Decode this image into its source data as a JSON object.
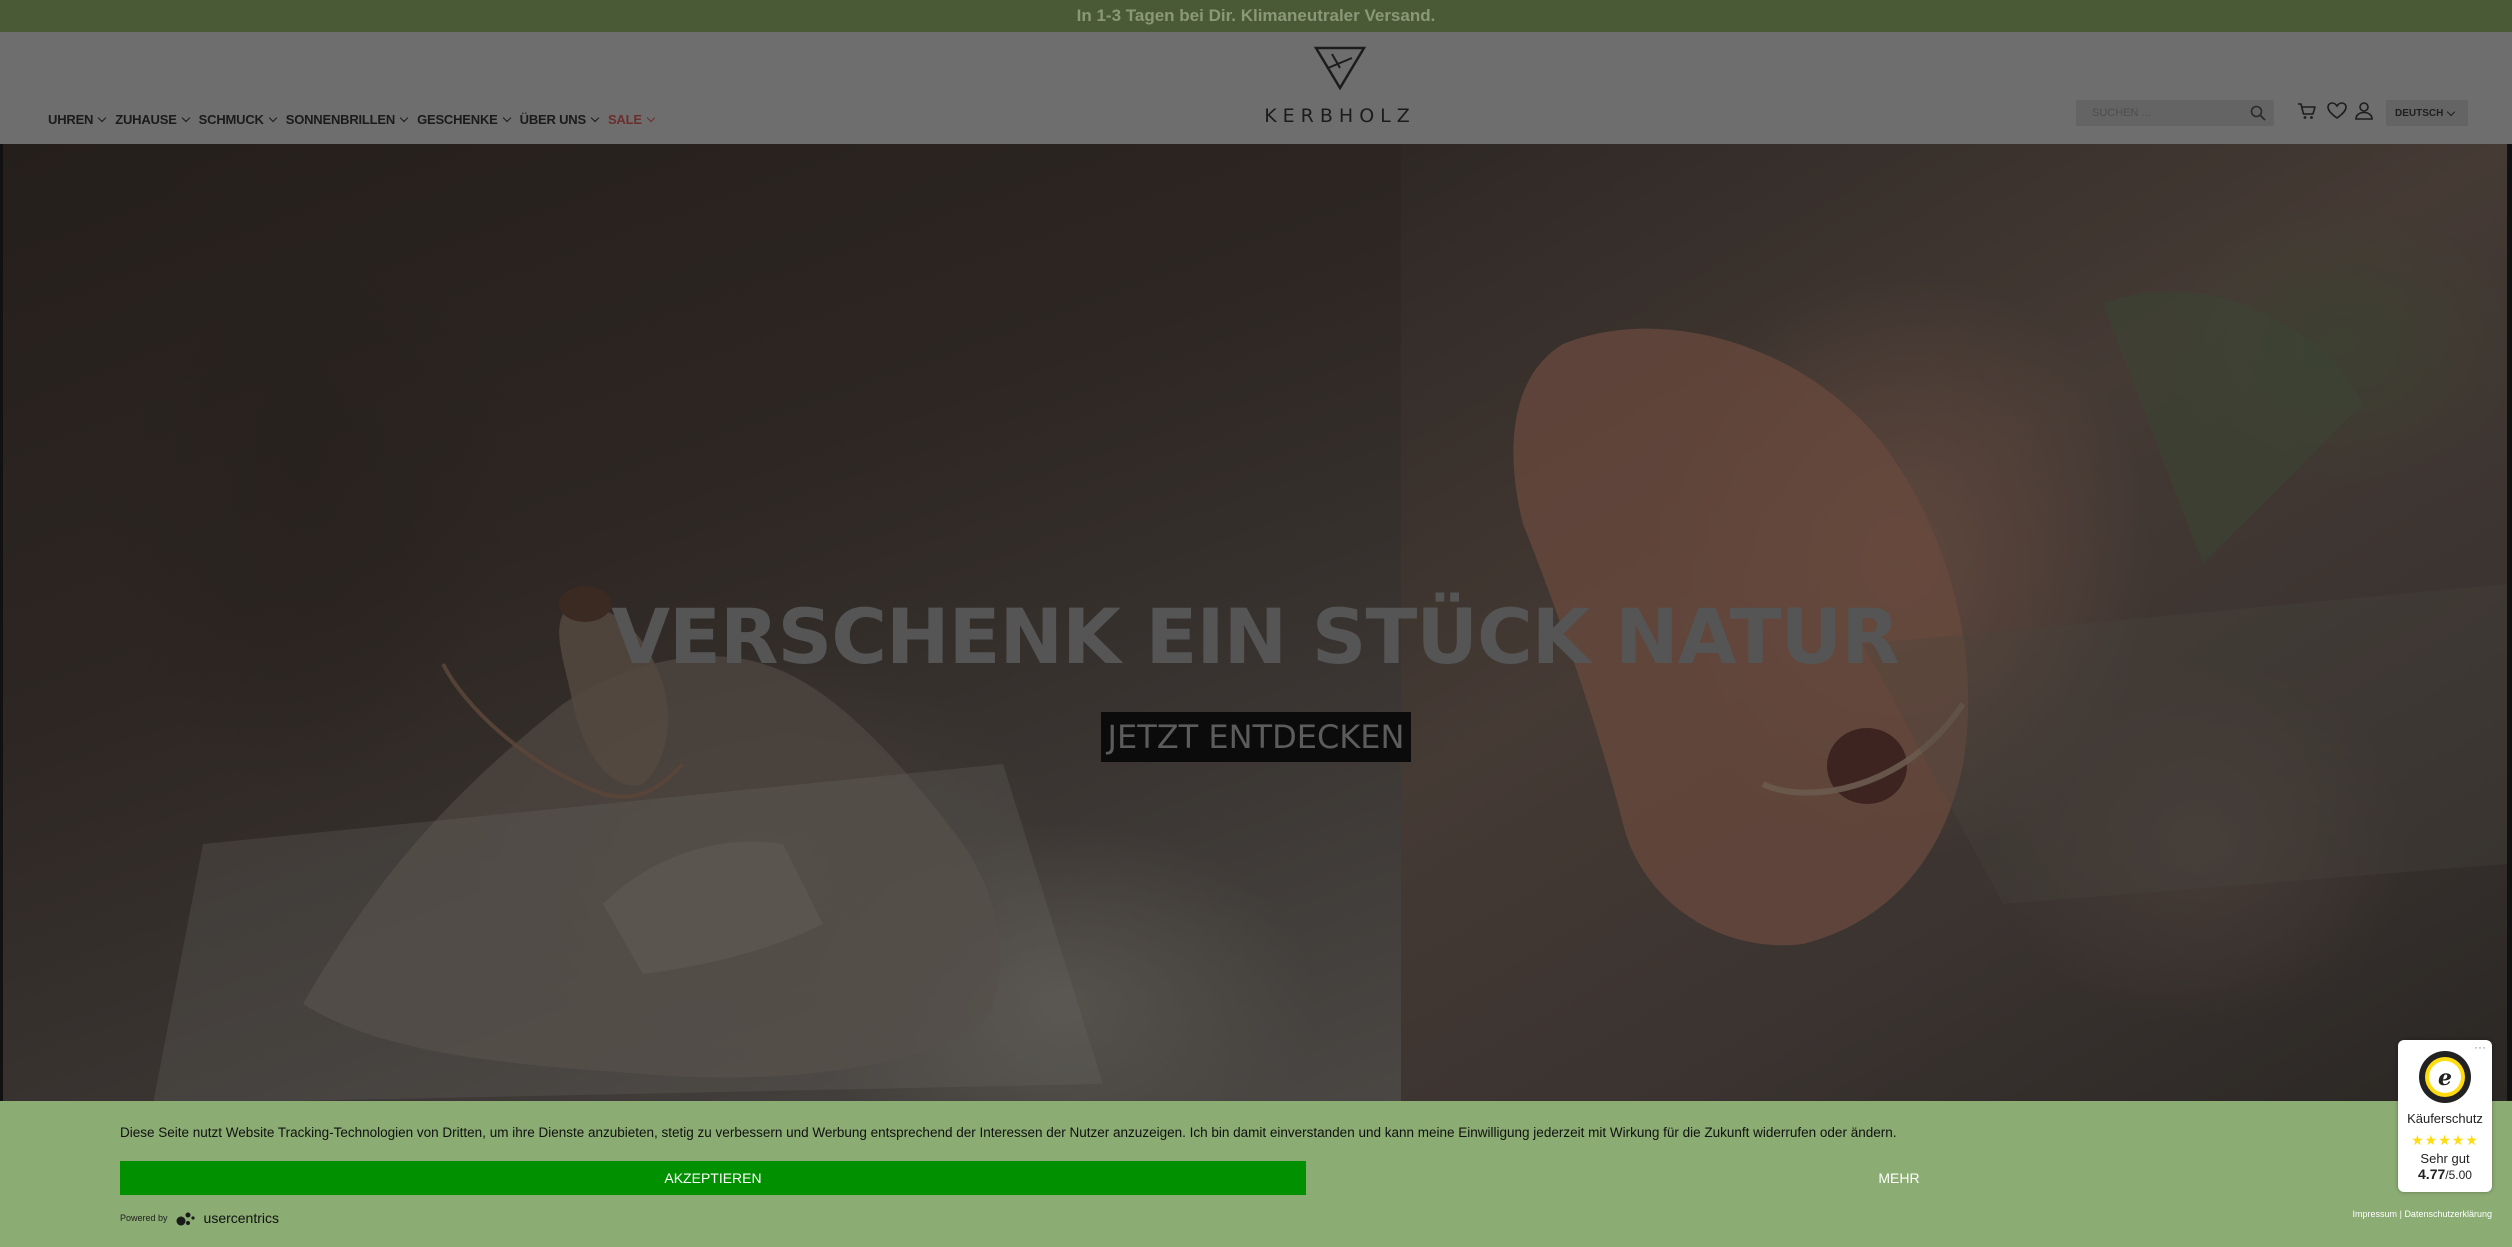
{
  "promo_bar": {
    "text": "In 1-3 Tagen bei Dir. Klimaneutraler Versand."
  },
  "header": {
    "nav": [
      {
        "label": "UHREN"
      },
      {
        "label": "ZUHAUSE"
      },
      {
        "label": "SCHMUCK"
      },
      {
        "label": "SONNENBRILLEN"
      },
      {
        "label": "GESCHENKE"
      },
      {
        "label": "ÜBER UNS"
      },
      {
        "label": "SALE"
      }
    ],
    "logo_text": "KERBHOLZ",
    "search": {
      "placeholder": "SUCHEN ..."
    },
    "icons": [
      "cart-icon",
      "wishlist-heart-icon",
      "account-user-icon"
    ],
    "language": "DEUTSCH"
  },
  "hero": {
    "title": "VERSCHENK EIN STÜCK NATUR",
    "cta_label": "JETZT ENTDECKEN"
  },
  "cookie_banner": {
    "text": "Diese Seite nutzt Website Tracking-Technologien von Dritten, um ihre Dienste anzubieten, stetig zu verbessern und Werbung entsprechend der Interessen der Nutzer anzuzeigen. Ich bin damit einverstanden und kann meine Einwilligung jederzeit mit Wirkung für die Zukunft widerrufen oder ändern.",
    "accept_label": "AKZEPTIEREN",
    "more_label": "MEHR",
    "powered_by": "Powered by",
    "brand": "usercentrics",
    "impressum": "Impressum",
    "separator": "|",
    "privacy": "Datenschutzerklärung"
  },
  "trusted_shops": {
    "more": "···",
    "label": "Käuferschutz",
    "stars": "★★★★★",
    "rating_text": "Sehr gut",
    "score": "4.77",
    "score_max": "/5.00"
  },
  "colors": {
    "promo_bg": "#4a5a37",
    "cookie_bg": "#8bac73",
    "accept_bg": "#009000",
    "star": "#ffdc0f"
  }
}
